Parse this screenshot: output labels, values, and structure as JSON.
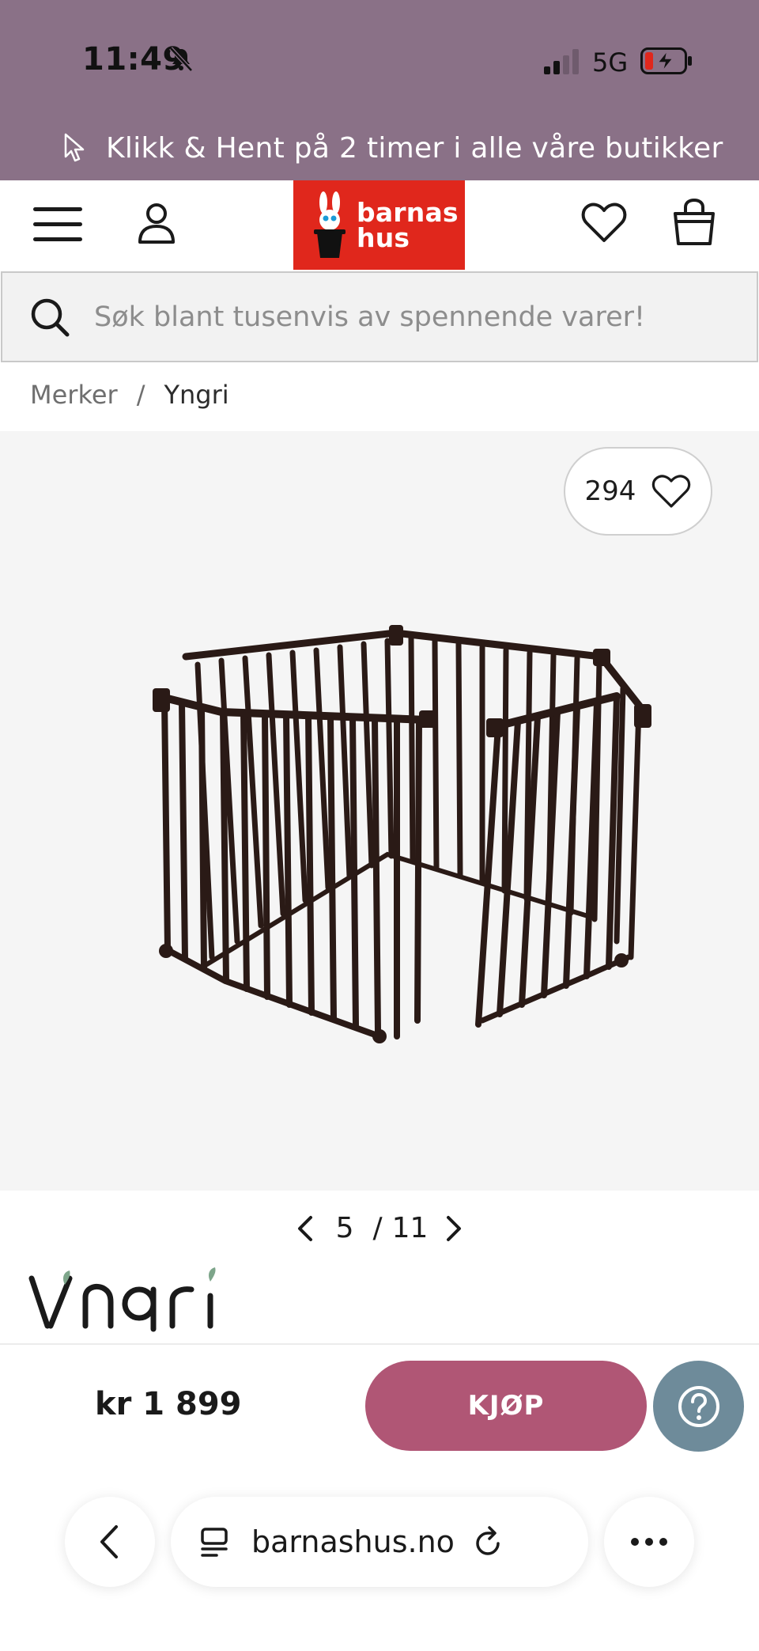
{
  "status_bar": {
    "time": "11:49",
    "network": "5G"
  },
  "promo": {
    "text": "Klikk & Hent på 2 timer i alle våre butikker"
  },
  "header": {
    "logo_line1": "barnas",
    "logo_line2": "hus",
    "brand_color": "#e0271c"
  },
  "search": {
    "placeholder": "Søk blant tusenvis av spennende varer!"
  },
  "breadcrumb": {
    "items": [
      "Merker",
      "Yngri"
    ],
    "separator": "/"
  },
  "gallery": {
    "favorite_count": "294",
    "current_page": "5",
    "separator": "/",
    "total_pages": "11"
  },
  "product": {
    "brand": "Yngri"
  },
  "buy_bar": {
    "price": "kr 1 899",
    "buy_label": "KJØP",
    "buy_color": "#b05675",
    "help_color": "#6e8b9a"
  },
  "browser": {
    "url": "barnashus.no"
  },
  "colors": {
    "top_band": "#8a7187"
  }
}
